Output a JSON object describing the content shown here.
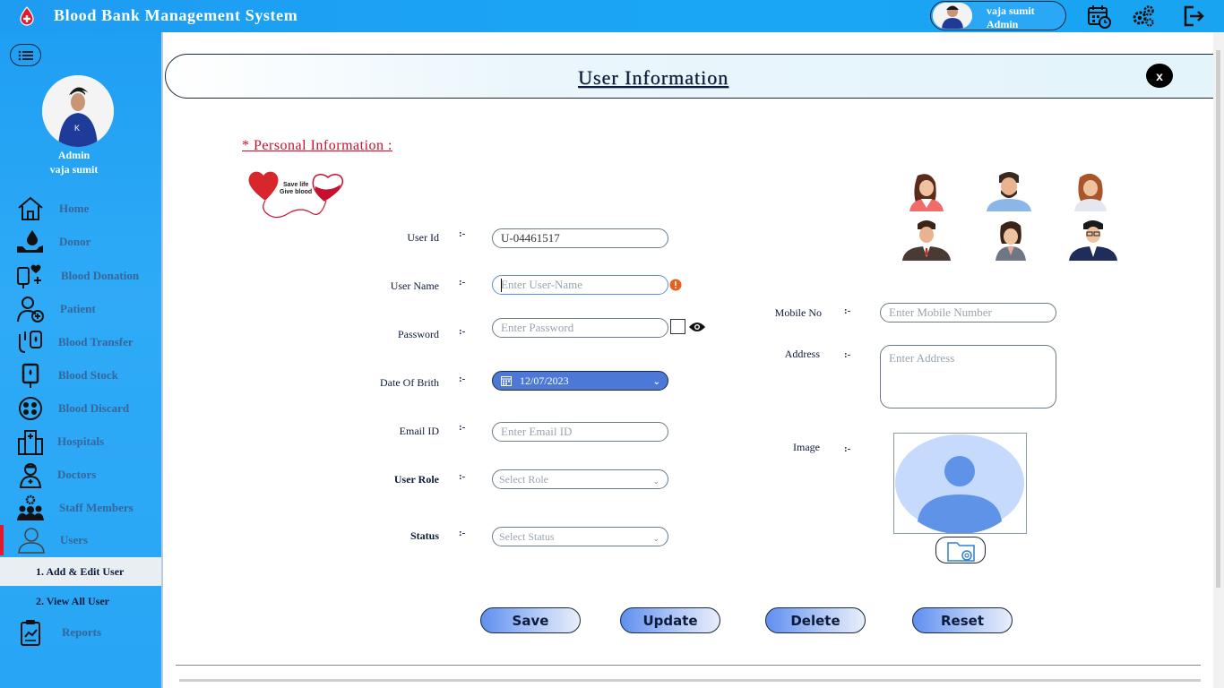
{
  "app": {
    "title": "Blood Bank Management System"
  },
  "topbar": {
    "user_name": "vaja sumit",
    "user_role": "Admin"
  },
  "sidebar": {
    "role": "Admin",
    "name": "vaja sumit",
    "items": [
      {
        "label": "Home",
        "icon": "home-icon"
      },
      {
        "label": "Donor",
        "icon": "donor-icon"
      },
      {
        "label": "Blood Donation",
        "icon": "blood-donation-icon"
      },
      {
        "label": "Patient",
        "icon": "patient-icon"
      },
      {
        "label": "Blood Transfer",
        "icon": "blood-transfer-icon"
      },
      {
        "label": "Blood Stock",
        "icon": "blood-stock-icon"
      },
      {
        "label": "Blood Discard",
        "icon": "blood-discard-icon"
      },
      {
        "label": "Hospitals",
        "icon": "hospital-icon"
      },
      {
        "label": "Doctors",
        "icon": "doctor-icon"
      },
      {
        "label": "Staff Members",
        "icon": "staff-icon"
      },
      {
        "label": "Users",
        "icon": "users-icon"
      }
    ],
    "sub_items": [
      {
        "label": "1.  Add & Edit User"
      },
      {
        "label": "2.  View All User"
      }
    ],
    "reports": {
      "label": "Reports",
      "icon": "reports-icon"
    }
  },
  "header": {
    "title": "User Information",
    "close": "x"
  },
  "section": {
    "title": "*  Personal Information  :"
  },
  "logo": {
    "line1": "Save life",
    "line2": "Give blood"
  },
  "form": {
    "colon": ":-",
    "user_id": {
      "label": "User Id",
      "value": "U-04461517"
    },
    "user_name": {
      "label": "User Name",
      "placeholder": "Enter User-Name"
    },
    "password": {
      "label": "Password",
      "placeholder": "Enter Password"
    },
    "dob": {
      "label": "Date Of Brith",
      "value": "12/07/2023"
    },
    "email": {
      "label": "Email ID",
      "placeholder": "Enter Email ID"
    },
    "role": {
      "label": "User Role",
      "placeholder": "Select Role"
    },
    "status": {
      "label": "Status",
      "placeholder": "Select Status"
    },
    "mobile": {
      "label": "Mobile No",
      "placeholder": "Enter Mobile Number"
    },
    "address": {
      "label": "Address",
      "placeholder": "Enter Address"
    },
    "image": {
      "label": "Image"
    }
  },
  "buttons": {
    "save": "Save",
    "update": "Update",
    "delete": "Delete",
    "reset": "Reset"
  },
  "colors": {
    "accent": "#1e9cf2",
    "brand_red": "#c8102e",
    "date_blue": "#4c78d8"
  }
}
